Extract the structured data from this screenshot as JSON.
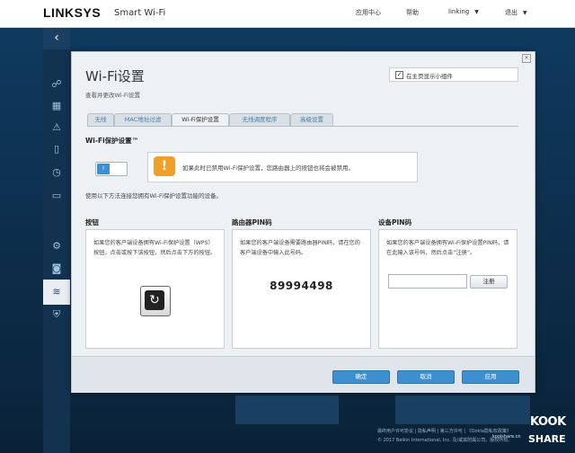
{
  "header": {
    "brand": "LINKSYS",
    "brand_sub": "Smart Wi-Fi",
    "nav": [
      "应用中心",
      "帮助"
    ],
    "user": "linking",
    "logout": "退出"
  },
  "dialog": {
    "title": "Wi-Fi设置",
    "subtitle": "查看并更改Wi-Fi设置",
    "show_widget_label": "在主页显示小组件",
    "show_widget_checked": "✓",
    "tabs": [
      {
        "label": "无线"
      },
      {
        "label": "MAC地址过滤"
      },
      {
        "label": "Wi-Fi保护设置"
      },
      {
        "label": "无线调度程序"
      },
      {
        "label": "高级设置"
      }
    ],
    "wps_heading": "Wi-Fi保护设置™",
    "toggle_label": "I",
    "warning_text": "如果此时已禁用Wi-Fi保护设置，您路由器上的按钮也将会被禁用。",
    "instructions": "使用以下方法连接您拥有Wi-Fi保护设置功能的设备。",
    "columns": {
      "button": {
        "heading": "按钮",
        "text": "如果您的客户端设备拥有Wi-Fi保护设置（WPS）按钮，点击或按下该按钮，然后点击下方的按钮。"
      },
      "router_pin": {
        "heading": "路由器PIN码",
        "text": "如果您的客户端设备需要路由器PIN码，请在您的客户端设备中输入此号码。",
        "pin": "89994498"
      },
      "device_pin": {
        "heading": "设备PIN码",
        "text": "如果您的客户端设备拥有Wi-Fi保护设置PIN码，请在此输入该号码，然后点击“注册”。",
        "input_value": "",
        "register_label": "注册"
      }
    },
    "buttons": {
      "ok": "确定",
      "cancel": "取消",
      "apply": "应用"
    }
  },
  "background": {
    "footer_line1": "最终用户许可协议 | 隐私声明 | 第三方许可 | 《Ookla隐私权政策》",
    "footer_line2": "© 2017 Belkin International, Inc. 及/或其附属公司。版权所有。"
  },
  "watermark": {
    "top": "KOOK",
    "bottom": "SHARE",
    "url": "koolshare.cn"
  },
  "icons": {
    "back": "chevron-left-icon",
    "warning": "exclamation-icon",
    "wps": "wps-arrows-icon"
  },
  "colors": {
    "accent": "#3d8fd1",
    "warning": "#f0a02a",
    "topbar": "#ffffff",
    "sidebar": "#13324f"
  }
}
